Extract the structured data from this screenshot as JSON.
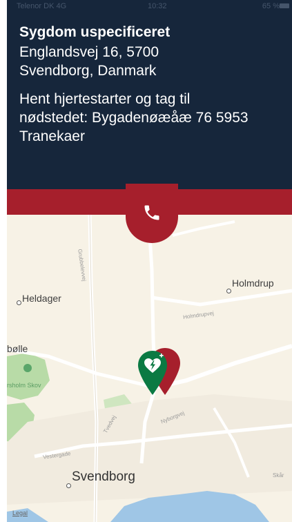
{
  "status_bar": {
    "carrier": "Telenor DK 4G",
    "time": "10:32",
    "battery": "65 %"
  },
  "incident": {
    "title": "Sygdom uspecificeret",
    "address_line1": "Englandsvej 16, 5700",
    "address_line2": "Svendborg, Danmark",
    "instruction_line1": "Hent hjertestarter og tag til",
    "instruction_line2": "nødstedet: Bygadenøæåæ 76 5953",
    "instruction_line3": "Tranekaer"
  },
  "map": {
    "places": {
      "heldager": "Heldager",
      "holmdrup": "Holmdrup",
      "bolle": "bølle",
      "svendborg": "Svendborg",
      "skarup": "Skår"
    },
    "parks": {
      "caroline": "rsholm Skov"
    },
    "roads": {
      "grubbe": "Grubbelevvej",
      "holmdrupvej": "Holmdrupvej",
      "nyborgvej": "Nyborgvej",
      "tvedvej": "Tvedvej",
      "ringvej": "Vestergade"
    },
    "legal": "Legal"
  },
  "colors": {
    "panel_bg": "#16263b",
    "band_red": "#a61f2c",
    "aed_green": "#0b7a43",
    "map_bg": "#f7f2e6",
    "water": "#9fc6e6",
    "park": "#b8dba7"
  },
  "icons": {
    "call": "phone-icon",
    "aed": "aed-heart-icon",
    "incident_pin": "location-pin-icon"
  }
}
